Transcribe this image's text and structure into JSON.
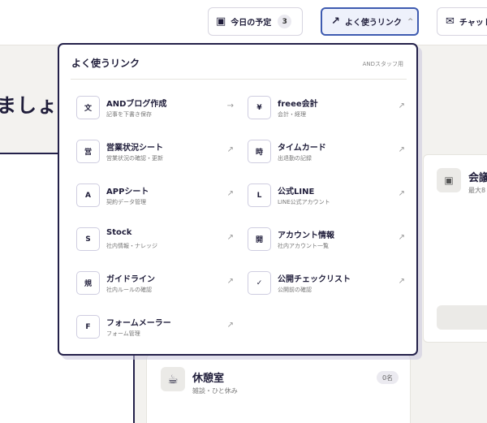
{
  "topbar": {
    "schedule": {
      "icon": "calendar-icon",
      "label": "今日の予定",
      "count": "3"
    },
    "links": {
      "icon": "arrow-up-right-icon",
      "label": "よく使うリンク",
      "caret": "^"
    },
    "chat": {
      "icon": "mail-icon",
      "label": "チャット"
    }
  },
  "background": {
    "heading": "ましょ",
    "room": {
      "title": "休憩室",
      "sub": "雑談・ひと休み",
      "count": "0名"
    },
    "right_card": {
      "title": "会議",
      "sub": "最大8"
    }
  },
  "dropdown": {
    "title": "よく使うリンク",
    "note": "ANDスタッフ用",
    "items": [
      {
        "tile": "文",
        "label": "ANDブログ作成",
        "sub": "記事を下書き保存",
        "arrow": "→"
      },
      {
        "tile": "¥",
        "label": "freee会計",
        "sub": "会計・経理",
        "arrow": "↗"
      },
      {
        "tile": "営",
        "label": "営業状況シート",
        "sub": "営業状況の確認・更新",
        "arrow": "↗"
      },
      {
        "tile": "時",
        "label": "タイムカード",
        "sub": "出退勤の記録",
        "arrow": "↗"
      },
      {
        "tile": "A",
        "label": "APPシート",
        "sub": "契約データ管理",
        "arrow": "↗"
      },
      {
        "tile": "L",
        "label": "公式LINE",
        "sub": "LINE公式アカウント",
        "arrow": "↗"
      },
      {
        "tile": "S",
        "label": "Stock",
        "sub": "社内情報・ナレッジ",
        "arrow": "↗"
      },
      {
        "tile": "開",
        "label": "アカウント情報",
        "sub": "社内アカウント一覧",
        "arrow": "↗"
      },
      {
        "tile": "規",
        "label": "ガイドライン",
        "sub": "社内ルールの確認",
        "arrow": "↗"
      },
      {
        "tile": "✓",
        "label": "公開チェックリスト",
        "sub": "公開前の確認",
        "arrow": "↗"
      },
      {
        "tile": "F",
        "label": "フォームメーラー",
        "sub": "フォーム管理",
        "arrow": "↗"
      }
    ]
  }
}
